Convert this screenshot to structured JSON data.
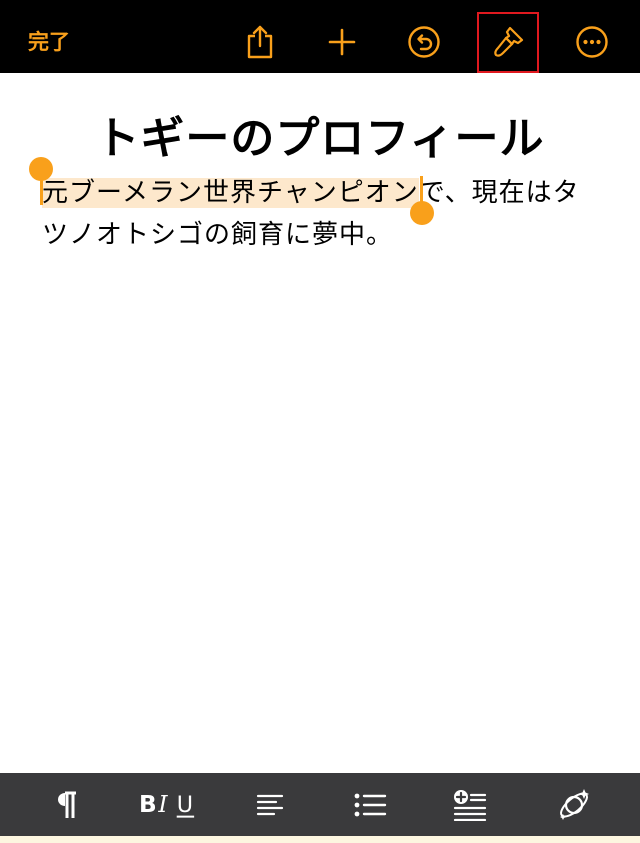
{
  "toolbar": {
    "done_label": "完了",
    "icons": [
      "share-icon",
      "add-icon",
      "undo-icon",
      "paintbrush-icon",
      "more-icon"
    ]
  },
  "document": {
    "title": "トギーのプロフィール",
    "selected_text": "元ブーメラン世界チャンピオン",
    "rest_text": "で、現在はタツノオトシゴの飼育に夢中。"
  },
  "format_bar": {
    "icons": [
      "paragraph-icon",
      "bold-italic-underline-icon",
      "align-left-icon",
      "bullet-list-icon",
      "insert-icon",
      "ai-writing-icon"
    ]
  },
  "colors": {
    "accent": "#f9a01b",
    "toolbar_bg": "#000000",
    "format_bar_bg": "#3a3a3c",
    "selection_bg": "#fde8cc",
    "highlight_border": "#e0191f"
  }
}
